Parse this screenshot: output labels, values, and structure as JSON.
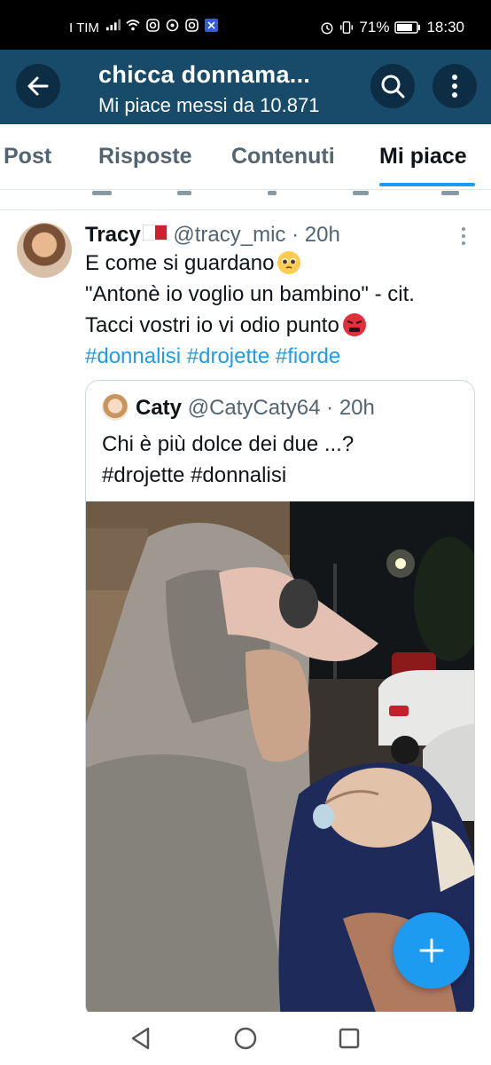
{
  "status_bar": {
    "carrier": "I TIM",
    "battery": "71%",
    "time": "18:30"
  },
  "header": {
    "title": "chicca donnama...",
    "subtitle": "Mi piace messi da 10.871"
  },
  "tabs": [
    {
      "label": "Post"
    },
    {
      "label": "Risposte"
    },
    {
      "label": "Contenuti"
    },
    {
      "label": "Mi piace"
    }
  ],
  "tweet": {
    "author": "Tracy",
    "handle": "@tracy_mic",
    "separator": "·",
    "time": "20h",
    "lines": [
      "E come si guardano",
      "\"Antonè io voglio un bambino\" - cit.",
      "Tacci vostri io vi odio punto"
    ],
    "hashtags": [
      "#donnalisi",
      "#drojette",
      "#fiorde"
    ]
  },
  "quote": {
    "author": "Caty",
    "handle": "@CatyCaty64",
    "separator": "·",
    "time": "20h",
    "lines": [
      "Chi è più dolce dei due ...?",
      "#drojette #donnalisi"
    ]
  },
  "icons": {
    "back": "arrow-left-icon",
    "search": "search-icon",
    "more": "more-vertical-icon",
    "compose": "plus-icon"
  },
  "colors": {
    "header_bg": "#184a69",
    "accent": "#1d9bf0",
    "muted": "#536471"
  }
}
